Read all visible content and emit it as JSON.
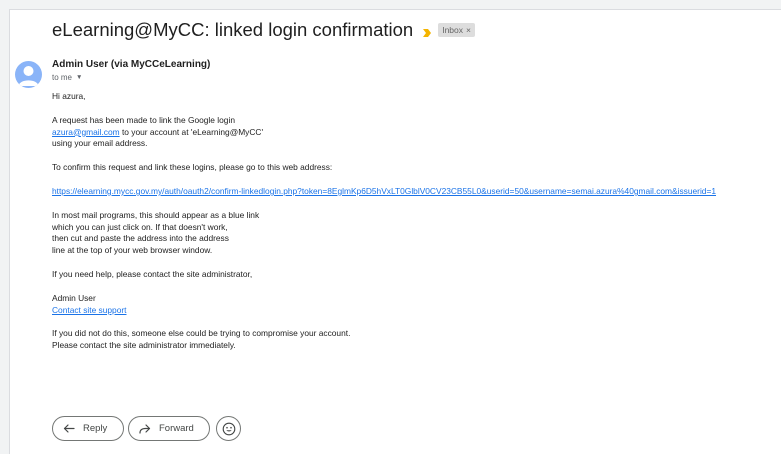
{
  "email": {
    "subject": "eLearning@MyCC: linked login confirmation",
    "label": "Inbox",
    "label_remove": "×",
    "sender": "Admin User (via MyCCeLearning)",
    "recipient": "to me",
    "body": {
      "greeting": "Hi  azura,",
      "intro_1": "A request has been made to link the Google login",
      "email_link": "azura@gmail.com",
      "intro_2": " to your account at 'eLearning@MyCC'",
      "intro_3": "using your email address.",
      "confirm_instruction": "To confirm this request and link these logins, please go to this web address:",
      "confirm_url": "https://elearning.mycc.gov.my/auth/oauth2/confirm-linkedlogin.php?token=8EglmKp6D5hVxLT0GlblV0CV23CB55L0&userid=50&username=semai.azura%40gmail.com&issuerid=1",
      "tip_1": "In most mail programs, this should appear as a blue link",
      "tip_2": "which you can just click on. If that doesn't work,",
      "tip_3": "then cut and paste the address into the address",
      "tip_4": "line at the top of your web browser window.",
      "help": "If you need help, please contact the site administrator,",
      "signature_name": "Admin User",
      "support_link": "Contact site support",
      "warning_1": "If you did not do this, someone else could be trying to compromise your account.",
      "warning_2": "Please contact the site administrator immediately."
    }
  },
  "actions": {
    "reply": "Reply",
    "forward": "Forward"
  },
  "icons": {
    "importance": "importance-marker-icon",
    "avatar": "person-avatar-icon",
    "caret": "caret-down-icon",
    "reply": "reply-arrow-icon",
    "forward": "forward-arrow-icon",
    "emoji": "emoji-smile-icon"
  },
  "colors": {
    "link": "#1a73e8",
    "importance": "#f4b400",
    "avatar": "#8ab4f8",
    "label_chip": "#dddddd"
  }
}
